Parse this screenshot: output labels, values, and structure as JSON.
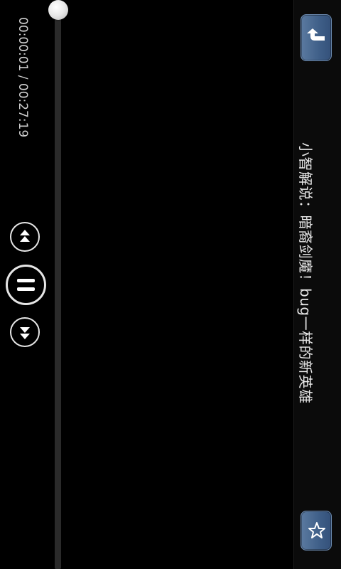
{
  "header": {
    "title": "小智解说：暗裔剑魔！bug一样的新英雄",
    "back_icon": "back-arrow-icon",
    "favorite_icon": "star-icon"
  },
  "player": {
    "time_display": "00:00:01 / 00:27:19",
    "progress_fraction": 0.0006,
    "state": "playing",
    "controls": {
      "previous_icon": "fast-backward-icon",
      "play_pause_icon": "pause-icon",
      "next_icon": "fast-forward-icon"
    }
  },
  "colors": {
    "background": "#000000",
    "button_accent": "#3f5f88",
    "text": "#e8e8e8"
  }
}
